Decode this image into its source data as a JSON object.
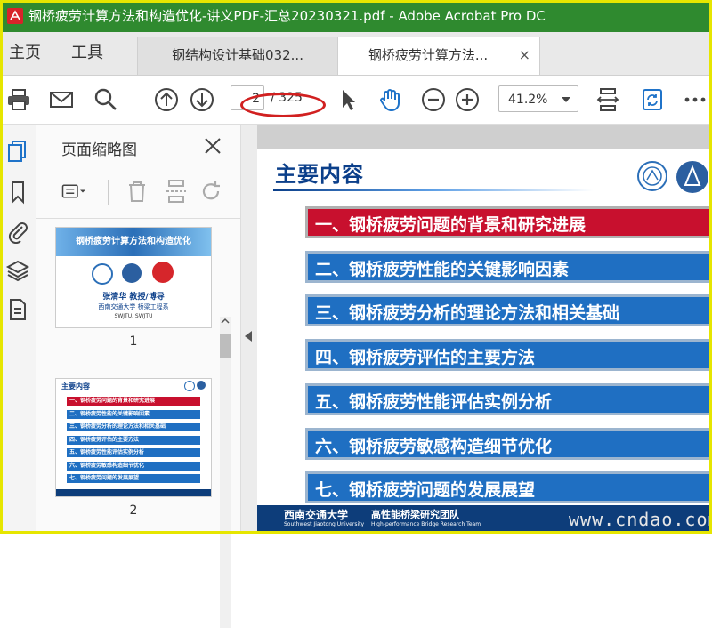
{
  "window": {
    "title": "钢桥疲劳计算方法和构造优化-讲义PDF-汇总20230321.pdf - Adobe Acrobat Pro DC"
  },
  "nav": {
    "home": "主页",
    "tools": "工具"
  },
  "tabs": [
    {
      "label": "钢结构设计基础032...",
      "active": false
    },
    {
      "label": "钢桥疲劳计算方法...",
      "active": true,
      "close": "×"
    }
  ],
  "toolbar": {
    "page_current": "2",
    "page_total": "/ 325",
    "zoom": "41.2%"
  },
  "panel": {
    "title": "页面缩略图"
  },
  "thumbnails": [
    {
      "number": "1",
      "banner": "钢桥疲劳计算方法和构造优化",
      "author": "张清华 教授/博导",
      "org": "西南交通大学 桥梁工程系",
      "sub": "SWJTU, SWJTU"
    },
    {
      "number": "2",
      "heading": "主要内容",
      "items": [
        "一、钢桥疲劳问题的背景和研究进展",
        "二、钢桥疲劳性能的关键影响因素",
        "三、钢桥疲劳分析的理论方法和相关基础",
        "四、钢桥疲劳评估的主要方法",
        "五、钢桥疲劳性能评估实例分析",
        "六、钢桥疲劳敏感构造细节优化",
        "七、钢桥疲劳问题的发展展望"
      ]
    }
  ],
  "slide": {
    "title": "主要内容",
    "items": [
      "一、钢桥疲劳问题的背景和研究进展",
      "二、钢桥疲劳性能的关键影响因素",
      "三、钢桥疲劳分析的理论方法和相关基础",
      "四、钢桥疲劳评估的主要方法",
      "五、钢桥疲劳性能评估实例分析",
      "六、钢桥疲劳敏感构造细节优化",
      "七、钢桥疲劳问题的发展展望"
    ],
    "footer_left": "西南交通大学",
    "footer_left_sub": "Southwest Jiaotong University",
    "footer_right": "高性能桥梁研究团队",
    "footer_right_sub": "High-performance Bridge Research Team",
    "watermark": "www.cndao.com"
  },
  "colors": {
    "titlebar": "#2f8a2f",
    "accent_blue": "#1f6fc2",
    "highlight_red": "#c8102e",
    "annotation_ring": "#d12020"
  }
}
